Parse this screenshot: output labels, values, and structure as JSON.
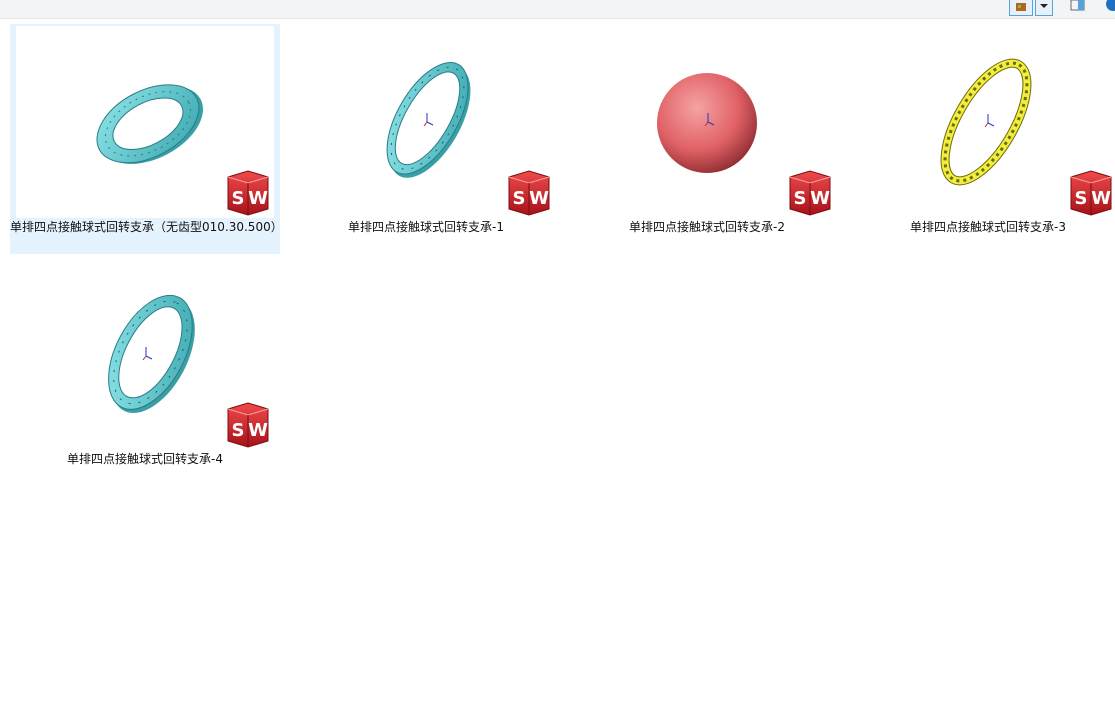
{
  "window": {
    "toolbar": {
      "view_icon": "thumbnail-view-icon",
      "dropdown_icon": "chevron-down-icon",
      "pane_icon": "preview-pane-icon",
      "help_icon": "help-icon",
      "accent": "#5aa1d8"
    }
  },
  "files": [
    {
      "name": "单排四点接触球式回转支承（无齿型010.30.500）",
      "icon": "solidworks-part-icon",
      "selected": true
    },
    {
      "name": "单排四点接触球式回转支承-1",
      "icon": "solidworks-part-icon",
      "selected": false
    },
    {
      "name": "单排四点接触球式回转支承-2",
      "icon": "solidworks-part-icon",
      "selected": false
    },
    {
      "name": "单排四点接触球式回转支承-3",
      "icon": "solidworks-part-icon",
      "selected": false
    },
    {
      "name": "单排四点接触球式回转支承-4",
      "icon": "solidworks-part-icon",
      "selected": false
    }
  ],
  "colors": {
    "selection": "#e5f3ff",
    "ring_teal": "#5cc8cf",
    "sphere_red": "#e86b6f",
    "cage_yellow": "#f2ee3a",
    "sw_red": "#d2232a"
  },
  "badge": {
    "text": "SW"
  }
}
